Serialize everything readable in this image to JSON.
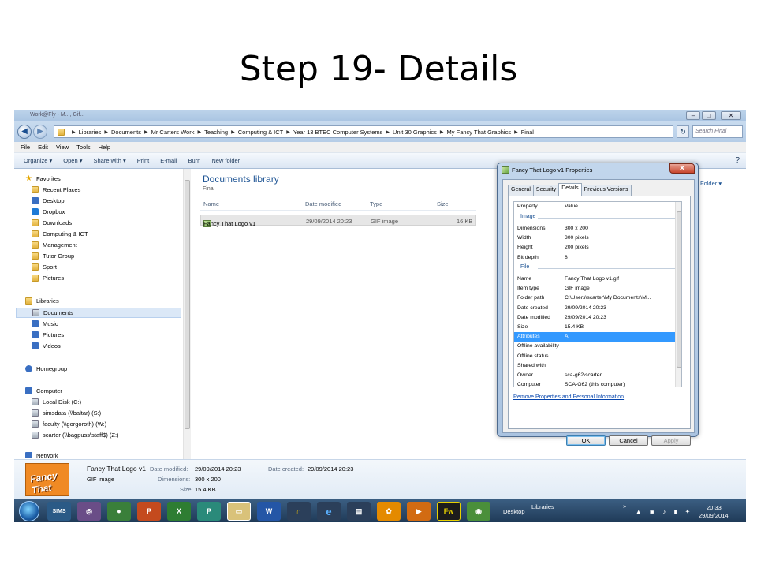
{
  "slide": {
    "title": "Step 19- Details"
  },
  "window": {
    "title": "Work@Fly - M..., Gif... ",
    "min": "–",
    "max": "□",
    "close": "✕"
  },
  "address": {
    "crumbs": [
      "Libraries",
      "Documents",
      "Mr Carters Work",
      "Teaching",
      "Computing & ICT",
      "Year 13 BTEC Computer Systems",
      "Unit 30 Graphics",
      "My Fancy That Graphics",
      "Final"
    ],
    "search_placeholder": "Search Final"
  },
  "menu": [
    "File",
    "Edit",
    "View",
    "Tools",
    "Help"
  ],
  "toolbar": {
    "organize": "Organize ▾",
    "open": "Open ▾",
    "share": "Share with ▾",
    "print": "Print",
    "email": "E-mail",
    "burn": "Burn",
    "newfolder": "New folder"
  },
  "nav": {
    "favorites": "Favorites",
    "fav_items": [
      "Recent Places",
      "Desktop",
      "Dropbox",
      "Downloads",
      "Computing & ICT",
      "Management",
      "Tutor Group",
      "Sport",
      "Pictures"
    ],
    "libraries": "Libraries",
    "lib_items": [
      "Documents",
      "Music",
      "Pictures",
      "Videos"
    ],
    "homegroup": "Homegroup",
    "computer": "Computer",
    "drives": [
      "Local Disk (C:)",
      "simsdata (\\\\baltar) (S:)",
      "faculty (\\\\gorgoroth) (W:)",
      "scarter (\\\\bagpuss\\staff$) (Z:)"
    ],
    "network": "Network"
  },
  "main": {
    "lib_title": "Documents library",
    "lib_sub": "Final",
    "arrange": "Folder ▾",
    "columns": [
      "Name",
      "Date modified",
      "Type",
      "Size"
    ],
    "files": [
      {
        "name": "Fancy That Logo v1",
        "modified": "29/09/2014 20:23",
        "type": "GIF image",
        "size": "16 KB"
      }
    ]
  },
  "details_pane": {
    "name": "Fancy That Logo v1",
    "type": "GIF image",
    "date_modified_label": "Date modified:",
    "date_modified": "29/09/2014 20:23",
    "date_created_label": "Date created:",
    "date_created": "29/09/2014 20:23",
    "dimensions_label": "Dimensions:",
    "dimensions": "300 x 200",
    "size_label": "Size:",
    "size": "15.4 KB",
    "thumb_text": "Fancy That"
  },
  "dialog": {
    "title": "Fancy That Logo v1 Properties",
    "tabs": [
      "General",
      "Security",
      "Details",
      "Previous Versions"
    ],
    "col_property": "Property",
    "col_value": "Value",
    "group_image": "Image",
    "group_file": "File",
    "image_props": [
      {
        "k": "Dimensions",
        "v": "300 x 200"
      },
      {
        "k": "Width",
        "v": "300 pixels"
      },
      {
        "k": "Height",
        "v": "200 pixels"
      },
      {
        "k": "Bit depth",
        "v": "8"
      }
    ],
    "file_props": [
      {
        "k": "Name",
        "v": "Fancy That Logo v1.gif"
      },
      {
        "k": "Item type",
        "v": "GIF image"
      },
      {
        "k": "Folder path",
        "v": "C:\\Users\\scarter\\My Documents\\M..."
      },
      {
        "k": "Date created",
        "v": "29/09/2014 20:23"
      },
      {
        "k": "Date modified",
        "v": "29/09/2014 20:23"
      },
      {
        "k": "Size",
        "v": "15.4 KB"
      },
      {
        "k": "Attributes",
        "v": "A"
      },
      {
        "k": "Offline availability",
        "v": ""
      },
      {
        "k": "Offline status",
        "v": ""
      },
      {
        "k": "Shared with",
        "v": ""
      },
      {
        "k": "Owner",
        "v": "sca-g62\\scarter"
      },
      {
        "k": "Computer",
        "v": "SCA-G62 (this computer)"
      }
    ],
    "remove_link": "Remove Properties and Personal Information",
    "ok": "OK",
    "cancel": "Cancel",
    "apply": "Apply"
  },
  "taskbar": {
    "sims": "SIMS",
    "desktop": "Desktop",
    "libraries": "Libraries",
    "time": "20:33",
    "date": "29/09/2014"
  },
  "colors": {
    "accent": "#1e5494",
    "selection": "#3399ff",
    "taskbar": "#1f3a57"
  }
}
